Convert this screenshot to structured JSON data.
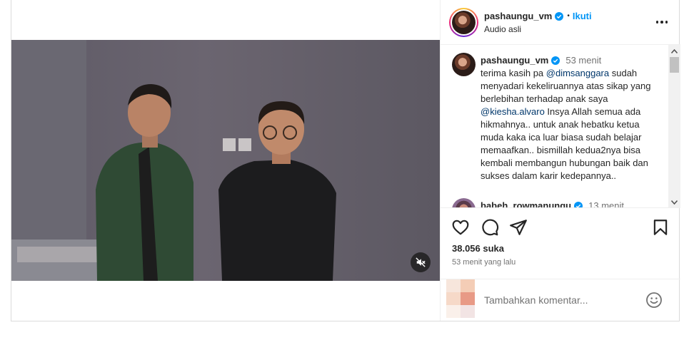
{
  "post": {
    "username": "pashaungu_vm",
    "follow_label": "Ikuti",
    "separator": "•",
    "audio_label": "Audio asli",
    "likes": "38.056 suka",
    "time_ago": "53 menit yang lalu"
  },
  "comments": [
    {
      "username": "pashaungu_vm",
      "time": "53 menit",
      "text_parts": {
        "p1": "terima kasih pa ",
        "m1": "@dimsanggara",
        "p2": " sudah menyadari kekeliruannya atas sikap yang berlebihan terhadap anak saya ",
        "m2": "@kiesha.alvaro",
        "p3": " Insya Allah semua ada hikmahnya.. untuk anak hebatku ketua muda kaka ica luar biasa sudah belajar memaafkan.. bismillah kedua2nya bisa kembali membangun hubungan baik dan sukses dalam karir kedepannya.."
      }
    },
    {
      "username": "babeh_rowmanungu",
      "time": "13 menit"
    }
  ],
  "comment_box": {
    "placeholder": "Tambahkan komentar..."
  },
  "icons": {
    "verified": "verified-badge-icon",
    "more": "more-options-icon",
    "like": "heart-icon",
    "comment": "comment-icon",
    "share": "share-icon",
    "save": "bookmark-icon",
    "emoji": "emoji-icon",
    "mute": "speaker-muted-icon"
  },
  "colors": {
    "accent": "#0095f6",
    "mention": "#00376b",
    "verified": "#0095f6"
  }
}
